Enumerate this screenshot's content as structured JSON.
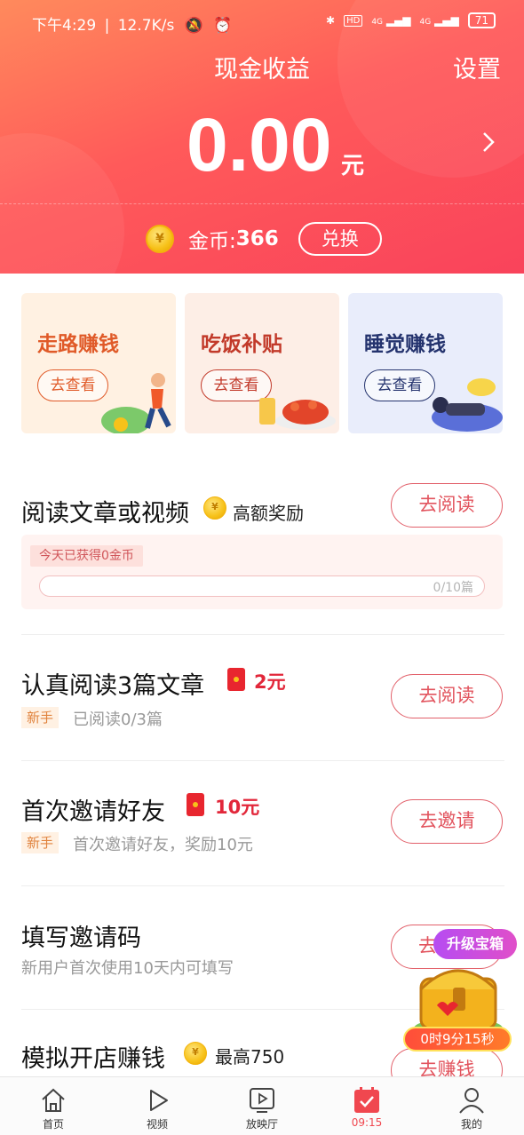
{
  "status_bar": {
    "time": "下午4:29",
    "speed": "12.7K/s",
    "battery": "71",
    "net_a": "4G",
    "net_b": "4G",
    "hd": "HD"
  },
  "header": {
    "title": "现金收益",
    "settings": "设置",
    "amount": "0.00",
    "unit": "元",
    "coin_label": "金币:",
    "coin_value": "366",
    "exchange": "兑换",
    "coin_symbol": "¥"
  },
  "cards": [
    {
      "title": "走路赚钱",
      "button": "去查看",
      "color": "#e05a28",
      "bg": "#fff1e2"
    },
    {
      "title": "吃饭补贴",
      "button": "去查看",
      "color": "#c23a2a",
      "bg": "#fdeee6"
    },
    {
      "title": "睡觉赚钱",
      "button": "去查看",
      "color": "#24336e",
      "bg": "#e9edfb"
    }
  ],
  "tasks": {
    "read": {
      "title": "阅读文章或视频",
      "reward": "高额奖励",
      "button": "去阅读",
      "today": "今天已获得0金币",
      "progress_text": "0/10篇",
      "progress": 0
    },
    "careful": {
      "title": "认真阅读3篇文章",
      "reward": "2元",
      "badge": "新手",
      "sub": "已阅读0/3篇",
      "button": "去阅读"
    },
    "invite": {
      "title": "首次邀请好友",
      "reward": "10元",
      "badge": "新手",
      "sub": "首次邀请好友，奖励10元",
      "button": "去邀请"
    },
    "code": {
      "title": "填写邀请码",
      "sub": "新用户首次使用10天内可填写",
      "button": "去"
    },
    "shop": {
      "title": "模拟开店赚钱",
      "reward": "最高750",
      "button": "去赚钱"
    }
  },
  "treasure": {
    "tag": "升级宝箱",
    "timer": "0时9分15秒"
  },
  "nav": [
    {
      "label": "首页",
      "icon": "home-icon"
    },
    {
      "label": "视频",
      "icon": "play-icon"
    },
    {
      "label": "放映厅",
      "icon": "tv-icon"
    },
    {
      "label": "09:15",
      "icon": "checkin-icon",
      "active": true
    },
    {
      "label": "我的",
      "icon": "user-icon"
    }
  ],
  "colors": {
    "accent": "#f9435b",
    "active_nav": "#f0474f"
  }
}
